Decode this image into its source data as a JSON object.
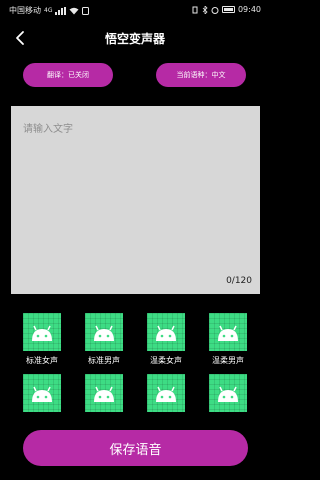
{
  "status_bar": {
    "carrier": "中国移动",
    "network": "4G",
    "battery_level": "",
    "time": "09:40"
  },
  "header": {
    "title": "悟空变声器"
  },
  "toggles": {
    "translate_label": "翻译：已关闭",
    "language_label": "当前语种：中文"
  },
  "text_input": {
    "placeholder": "请输入文字",
    "value": "",
    "counter": "0/120"
  },
  "voices": [
    {
      "label": "标准女声"
    },
    {
      "label": "标准男声"
    },
    {
      "label": "温柔女声"
    },
    {
      "label": "温柔男声"
    },
    {
      "label": ""
    },
    {
      "label": ""
    },
    {
      "label": ""
    },
    {
      "label": ""
    }
  ],
  "footer": {
    "save_label": "保存语音"
  },
  "colors": {
    "accent": "#b62aa5",
    "voice_tile": "#3ddc84",
    "input_bg": "#d7d7d7",
    "background": "#000000"
  },
  "icons": {
    "back": "chevron-left-icon",
    "voice_tile": "android-robot-icon"
  }
}
